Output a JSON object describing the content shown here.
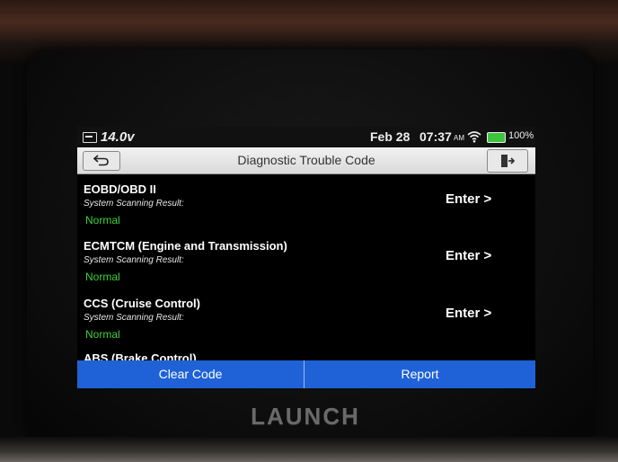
{
  "device": {
    "brand": "LAUNCH"
  },
  "status_bar": {
    "voltage": "14.0v",
    "date": "Feb 28",
    "time": "07:37",
    "ampm": "AM",
    "battery": "100%"
  },
  "header": {
    "title": "Diagnostic Trouble Code"
  },
  "systems": [
    {
      "name": "EOBD/OBD II",
      "label": "System Scanning Result:",
      "result": "Normal",
      "action": "Enter >"
    },
    {
      "name": "ECMTCM (Engine and Transmission)",
      "label": "System Scanning Result:",
      "result": "Normal",
      "action": "Enter >"
    },
    {
      "name": "CCS (Cruise Control)",
      "label": "System Scanning Result:",
      "result": "Normal",
      "action": "Enter >"
    }
  ],
  "partial_system": {
    "name": "ABS (Brake Control)"
  },
  "footer": {
    "clear_label": "Clear Code",
    "report_label": "Report"
  },
  "colors": {
    "accent": "#1f62d8",
    "normal_status": "#3bd13b",
    "battery": "#3ec53e"
  },
  "icons": [
    "battery-voltage-icon",
    "wifi-icon",
    "battery-icon",
    "back-arrow-icon",
    "exit-icon"
  ]
}
